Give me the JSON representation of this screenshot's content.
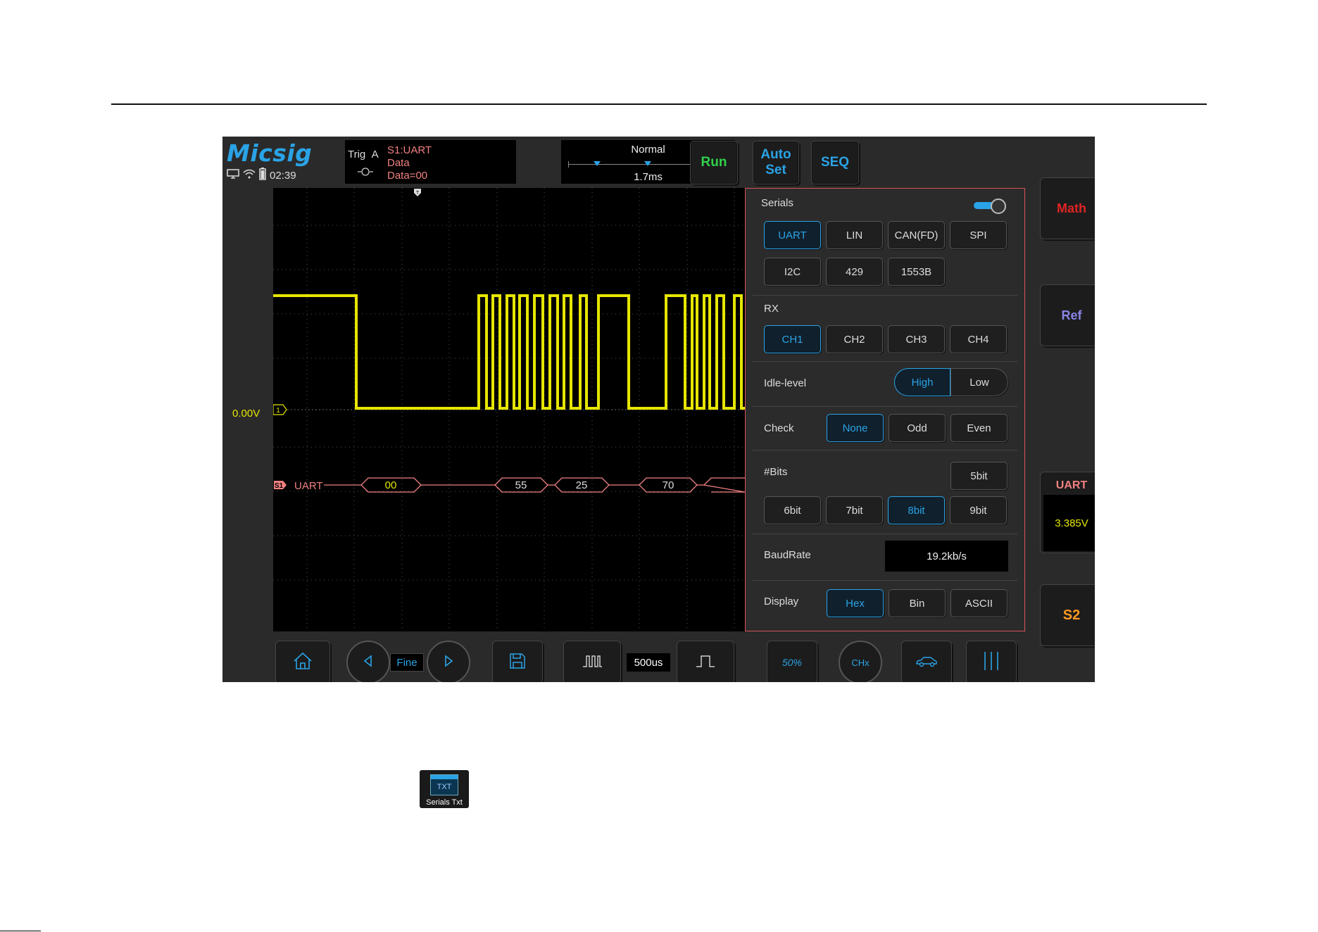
{
  "header": {
    "logo": "Micsig",
    "clock": "02:39"
  },
  "trigger": {
    "label": "Trig",
    "source": "A",
    "lines": [
      "S1:UART",
      "Data",
      "Data=00"
    ]
  },
  "timebase": {
    "mode": "Normal",
    "position": "1.7ms"
  },
  "top_buttons": {
    "run": "Run",
    "auto_set_line1": "Auto",
    "auto_set_line2": "Set",
    "seq": "SEQ"
  },
  "colors": {
    "run": "#31d14a",
    "accent": "#2aa3e6",
    "math": "#e02424",
    "ref": "#8a84e6",
    "s2": "#ff9a1f",
    "channel1": "#e6e600",
    "serial": "#f08080"
  },
  "waveform": {
    "offset_label": "0.00V",
    "channel_marker": "1",
    "serial_marker": "S1",
    "serial_label": "UART",
    "decoded": [
      "00",
      "55",
      "25",
      "70"
    ]
  },
  "serial_panel": {
    "title": "Serials",
    "enabled": true,
    "protocols": [
      "UART",
      "LIN",
      "CAN(FD)",
      "SPI",
      "I2C",
      "429",
      "1553B"
    ],
    "selected_protocol": "UART",
    "rx": {
      "label": "RX",
      "options": [
        "CH1",
        "CH2",
        "CH3",
        "CH4"
      ],
      "selected": "CH1"
    },
    "idle_level": {
      "label": "Idle-level",
      "options": [
        "High",
        "Low"
      ],
      "selected": "High"
    },
    "check": {
      "label": "Check",
      "options": [
        "None",
        "Odd",
        "Even"
      ],
      "selected": "None"
    },
    "bits": {
      "label": "#Bits",
      "options": [
        "5bit",
        "6bit",
        "7bit",
        "8bit",
        "9bit"
      ],
      "selected": "8bit"
    },
    "baudrate": {
      "label": "BaudRate",
      "value": "19.2kb/s"
    },
    "display": {
      "label": "Display",
      "options": [
        "Hex",
        "Bin",
        "ASCII"
      ],
      "selected": "Hex"
    }
  },
  "side_buttons": {
    "math": "Math",
    "ref": "Ref",
    "uart_title": "UART",
    "uart_value": "3.385V",
    "s2": "S2"
  },
  "bottom_bar": {
    "fine": "Fine",
    "time_div": "500us",
    "fifty_percent": "50%",
    "chx": "CHx"
  },
  "app_icon": {
    "icon_text": "TXT",
    "caption": "Serials Txt"
  }
}
